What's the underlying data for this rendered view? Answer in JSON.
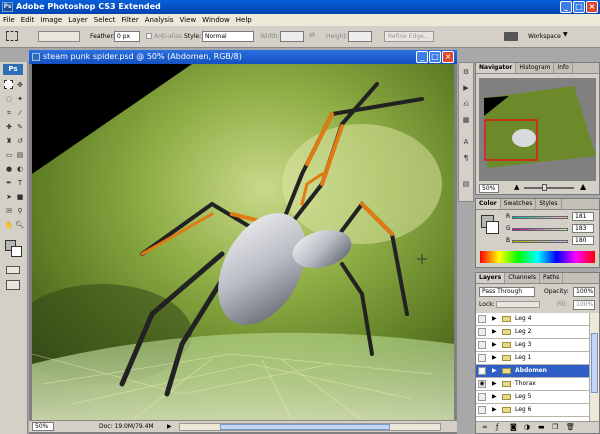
{
  "app": {
    "title": "Adobe Photoshop CS3 Extended",
    "logo": "Ps"
  },
  "menu": [
    "File",
    "Edit",
    "Image",
    "Layer",
    "Select",
    "Filter",
    "Analysis",
    "View",
    "Window",
    "Help"
  ],
  "options": {
    "feather_label": "Feather:",
    "feather_value": "0 px",
    "antialias_label": "Anti-alias",
    "style_label": "Style:",
    "style_value": "Normal",
    "width_label": "Width:",
    "height_label": "Height:",
    "refine_edge": "Refine Edge...",
    "workspace": "Workspace"
  },
  "document": {
    "title": "steam punk spider.psd @ 50% (Abdomen, RGB/8)",
    "zoom": "50%",
    "doc_info": "Doc: 19.0M/79.4M"
  },
  "navigator": {
    "tabs": [
      "Navigator",
      "Histogram",
      "Info"
    ],
    "zoom": "50%"
  },
  "color_panel": {
    "tabs": [
      "Color",
      "Swatches",
      "Styles"
    ],
    "r_label": "R",
    "r_value": "181",
    "g_label": "G",
    "g_value": "183",
    "b_label": "B",
    "b_value": "180",
    "fg_color": "#b5b7b4"
  },
  "layers_panel": {
    "tabs": [
      "Layers",
      "Channels",
      "Paths"
    ],
    "blend_mode": "Pass Through",
    "opacity_label": "Opacity:",
    "opacity_value": "100%",
    "lock_label": "Lock:",
    "fill_label": "Fill:",
    "fill_value": "100%",
    "layers": [
      {
        "name": "Leg 4",
        "visible": false,
        "selected": false
      },
      {
        "name": "Leg 2",
        "visible": false,
        "selected": false
      },
      {
        "name": "Leg 3",
        "visible": false,
        "selected": false
      },
      {
        "name": "Leg 1",
        "visible": false,
        "selected": false
      },
      {
        "name": "Abdomen",
        "visible": true,
        "selected": true
      },
      {
        "name": "Thorax",
        "visible": true,
        "selected": false
      },
      {
        "name": "Leg 5",
        "visible": false,
        "selected": false
      },
      {
        "name": "Leg 6",
        "visible": false,
        "selected": false
      }
    ]
  }
}
